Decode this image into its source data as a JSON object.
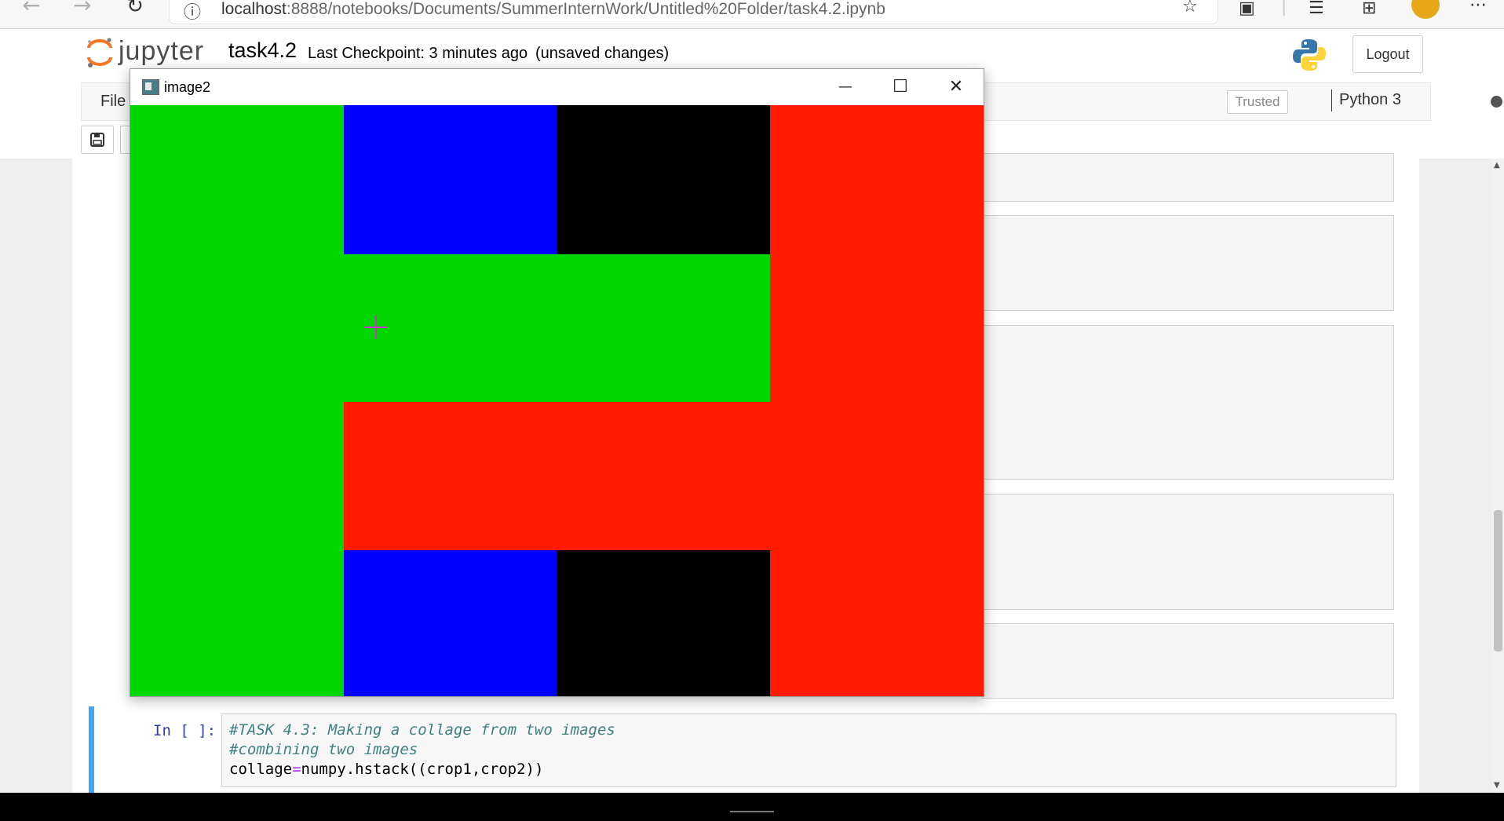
{
  "browser": {
    "back_icon": "←",
    "forward_icon": "→",
    "refresh_icon": "↻",
    "info_icon": "ⓘ",
    "url_host": "localhost",
    "url_rest": ":8888/notebooks/Documents/SummerInternWork/Untitled%20Folder/task4.2.ipynb",
    "favorite_icon": "☆",
    "collections_icon": "⊞",
    "favorites_list_icon": "☰",
    "more_icon": "⋯"
  },
  "jupyter": {
    "logo_text": "jupyter",
    "notebook_title": "task4.2",
    "checkpoint": "Last Checkpoint: 3 minutes ago",
    "unsaved": "(unsaved changes)",
    "logout": "Logout",
    "menu_file": "File",
    "trusted": "Trusted",
    "kernel": "Python 3",
    "save_icon": "💾"
  },
  "image_window": {
    "title": "image2",
    "minimize": "—",
    "maximize": "☐",
    "close": "✕",
    "colors": {
      "green": "#00d600",
      "blue": "#0000ff",
      "black": "#000000",
      "red": "#ff1a00"
    }
  },
  "code_cell": {
    "prompt": "In [ ]:",
    "line1": "#TASK 4.3: Making a collage from two images",
    "line2": "#combining two images",
    "line3_a": "collage",
    "line3_op": "=",
    "line3_b": "numpy.hstack((crop1,crop2))"
  }
}
